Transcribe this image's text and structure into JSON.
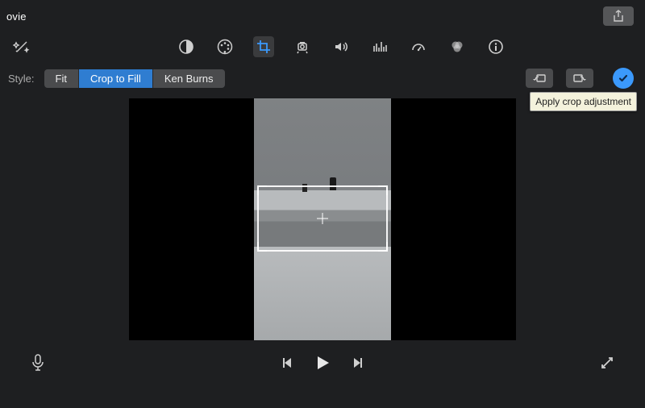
{
  "titlebar": {
    "title": "ovie"
  },
  "toolbar": {
    "tools": [
      {
        "name": "color-balance-icon"
      },
      {
        "name": "color-palette-icon"
      },
      {
        "name": "crop-icon",
        "active": true
      },
      {
        "name": "stabilize-icon"
      },
      {
        "name": "volume-icon"
      },
      {
        "name": "equalizer-icon"
      },
      {
        "name": "speed-icon"
      },
      {
        "name": "color-correction-icon"
      },
      {
        "name": "info-icon"
      }
    ]
  },
  "style_row": {
    "label": "Style:",
    "options": [
      {
        "label": "Fit",
        "active": false
      },
      {
        "label": "Crop to Fill",
        "active": true
      },
      {
        "label": "Ken Burns",
        "active": false
      }
    ],
    "apply_tooltip": "Apply crop adjustment"
  }
}
